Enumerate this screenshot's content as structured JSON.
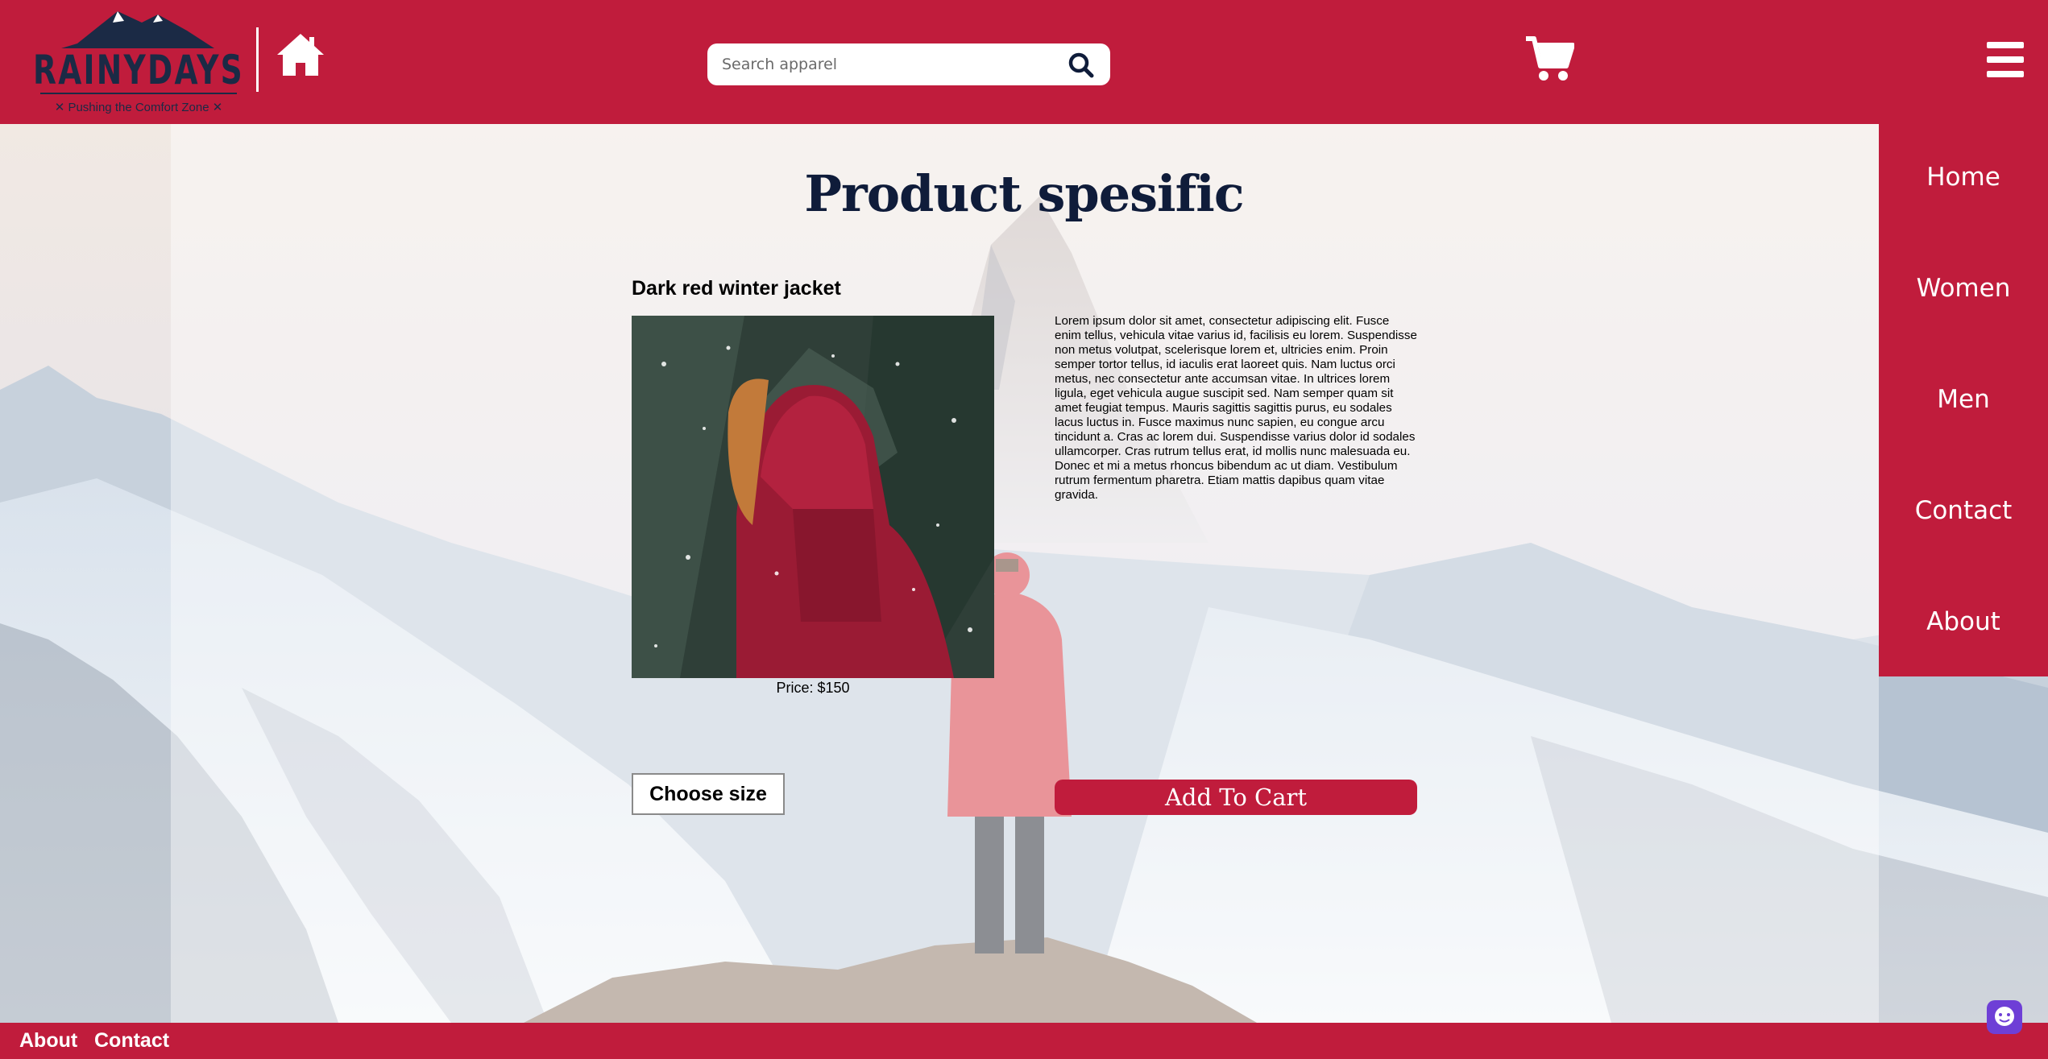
{
  "header": {
    "logo_text": "RAINYDAYS",
    "logo_tagline": "✕ Pushing the Comfort Zone ✕",
    "home_icon": "home-icon",
    "search_placeholder": "Search apparel",
    "search_icon": "search-icon",
    "cart_icon": "cart-icon",
    "menu_icon": "hamburger-menu-icon"
  },
  "main": {
    "title": "Product spesific",
    "product": {
      "name": "Dark red winter jacket",
      "price": "Price: $150",
      "description": "Lorem ipsum dolor sit amet, consectetur adipiscing elit. Fusce enim tellus, vehicula vitae varius id, facilisis eu lorem. Suspendisse non metus volutpat, scelerisque lorem et, ultricies enim. Proin semper tortor tellus, id iaculis erat laoreet quis. Nam luctus orci metus, nec consectetur ante accumsan vitae. In ultrices lorem ligula, eget vehicula augue suscipit sed. Nam semper quam sit amet feugiat tempus. Mauris sagittis sagittis purus, eu sodales lacus luctus in. Fusce maximus nunc sapien, eu congue arcu tincidunt a. Cras ac lorem dui. Suspendisse varius dolor id sodales ullamcorper. Cras rutrum tellus erat, id mollis nunc malesuada eu. Donec et mi a metus rhoncus bibendum ac ut diam. Vestibulum rutrum fermentum pharetra. Etiam mattis dapibus quam vitae gravida."
    },
    "size_button": "Choose size",
    "add_to_cart_button": "Add To Cart"
  },
  "side_nav": {
    "items": [
      {
        "label": "Home"
      },
      {
        "label": "Women"
      },
      {
        "label": "Men"
      },
      {
        "label": "Contact"
      },
      {
        "label": "About"
      }
    ]
  },
  "footer": {
    "links": [
      {
        "label": "About"
      },
      {
        "label": "Contact"
      }
    ],
    "chat_icon": "chat-widget-icon"
  },
  "colors": {
    "brand": "#c01c3c",
    "title": "#0f1c3a",
    "white": "#ffffff"
  }
}
